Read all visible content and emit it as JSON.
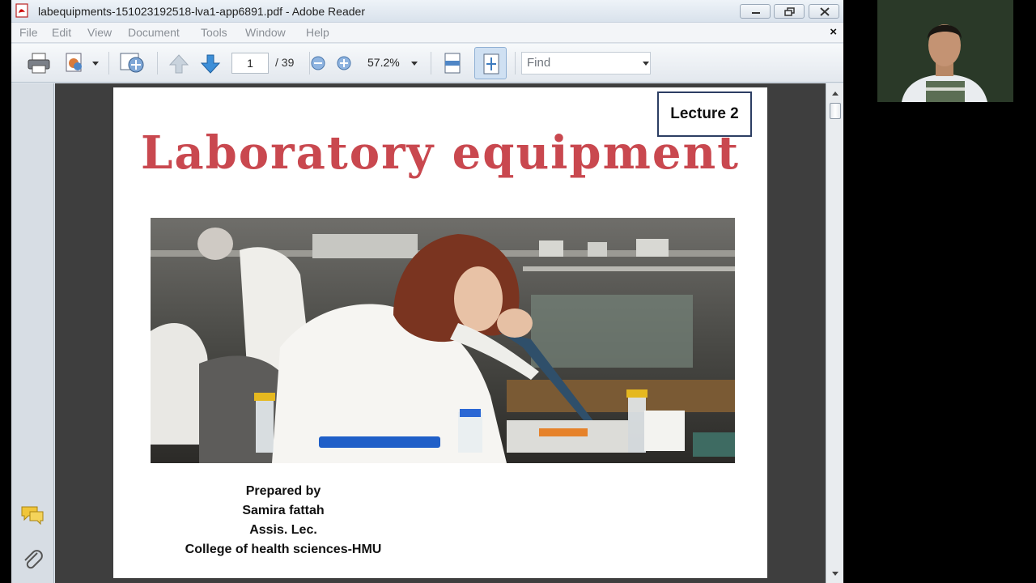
{
  "window": {
    "title": "labequipments-151023192518-lva1-app6891.pdf - Adobe Reader"
  },
  "menu": {
    "items": [
      "File",
      "Edit",
      "View",
      "Document",
      "Tools",
      "Window",
      "Help"
    ],
    "close_glyph": "×"
  },
  "toolbar": {
    "current_page": "1",
    "page_total": "/ 39",
    "zoom": "57.2%",
    "find_placeholder": "Find"
  },
  "document": {
    "badge": "Lecture 2",
    "headline": "Laboratory equipment",
    "credits": [
      "Prepared by",
      "Samira fattah",
      "Assis. Lec.",
      "College of health sciences-HMU"
    ]
  },
  "colors": {
    "headline": "#c9484f",
    "viewer_bg": "#3e3e3e",
    "badge_border": "#2c3e63"
  },
  "icons": [
    "pdf-icon",
    "minimize-icon",
    "restore-icon",
    "close-icon",
    "print-icon",
    "share-icon",
    "collaborate-icon",
    "previous-page-icon",
    "next-page-icon",
    "zoom-out-icon",
    "zoom-in-icon",
    "fit-width-icon",
    "fit-page-icon",
    "comments-icon",
    "attachment-icon"
  ]
}
